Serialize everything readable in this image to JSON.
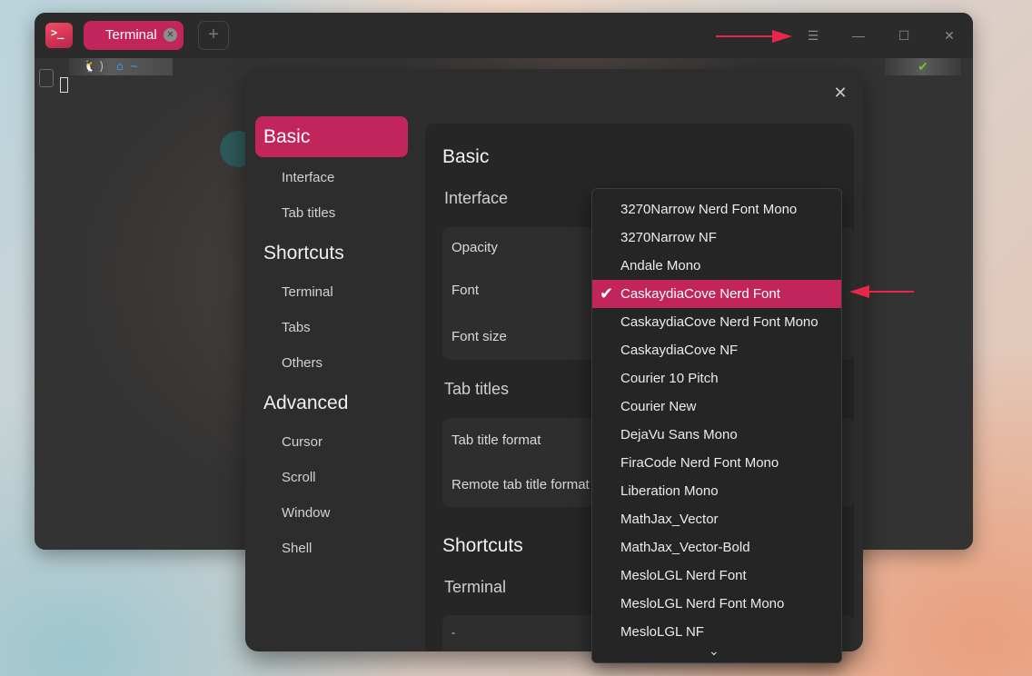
{
  "app": {
    "icon": "terminal-app-icon",
    "accent_color": "#c2255c"
  },
  "tabs": [
    {
      "label": "Terminal",
      "close_icon": "close-icon"
    }
  ],
  "titlebar": {
    "new_tab_icon": "plus-icon",
    "menu_icon": "hamburger-menu-icon",
    "minimize_icon": "minimize-icon",
    "maximize_icon": "maximize-icon",
    "close_icon": "close-icon"
  },
  "terminal": {
    "prompt": {
      "os_icon": "linux-tux-icon",
      "separator": ")",
      "directory": "⌂ ~"
    },
    "status_check": "✔"
  },
  "settings": {
    "close_glyph": "✕",
    "nav": {
      "basic": "Basic",
      "interface": "Interface",
      "tab_titles": "Tab titles",
      "shortcuts": "Shortcuts",
      "terminal": "Terminal",
      "tabs": "Tabs",
      "others": "Others",
      "advanced": "Advanced",
      "cursor": "Cursor",
      "scroll": "Scroll",
      "window": "Window",
      "shell": "Shell"
    },
    "content": {
      "basic_heading": "Basic",
      "interface_heading": "Interface",
      "opacity_label": "Opacity",
      "font_label": "Font",
      "font_size_label": "Font size",
      "tab_titles_heading": "Tab titles",
      "tab_title_format_label": "Tab title format",
      "remote_tab_title_format_label": "Remote tab title format",
      "shortcuts_heading": "Shortcuts",
      "terminal_heading": "Terminal",
      "cut_off_row_text": "-"
    }
  },
  "font_dropdown": {
    "selected": "CaskaydiaCove Nerd Font",
    "check_glyph": "✔",
    "scroll_down_glyph": "⌵",
    "options": [
      "3270Narrow Nerd Font Mono",
      "3270Narrow NF",
      "Andale Mono",
      "CaskaydiaCove Nerd Font",
      "CaskaydiaCove Nerd Font Mono",
      "CaskaydiaCove NF",
      "Courier 10 Pitch",
      "Courier New",
      "DejaVu Sans Mono",
      "FiraCode Nerd Font Mono",
      "Liberation Mono",
      "MathJax_Vector",
      "MathJax_Vector-Bold",
      "MesloLGL Nerd Font",
      "MesloLGL Nerd Font Mono",
      "MesloLGL NF"
    ]
  },
  "annotations": {
    "arrow_color": "#e8264a"
  }
}
